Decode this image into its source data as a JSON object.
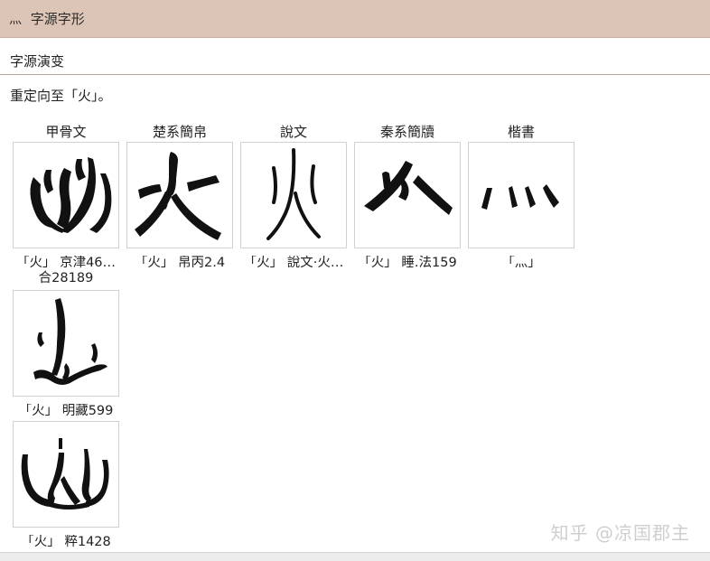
{
  "header": {
    "icon_text": "灬",
    "title": "字源字形"
  },
  "section_title": "字源演变",
  "description": "重定向至「火」。",
  "columns": [
    {
      "label": "甲骨文"
    },
    {
      "label": "楚系簡帛"
    },
    {
      "label": "說文"
    },
    {
      "label": "秦系簡牘"
    },
    {
      "label": "楷書"
    }
  ],
  "glyphs": [
    {
      "icon": "oracle-fire-glyph-1",
      "caption": "「火」 京津46…",
      "caption2": "合28189"
    },
    {
      "icon": "chu-fire-glyph",
      "caption": "「火」 帛丙2.4"
    },
    {
      "icon": "shuowen-fire-glyph",
      "caption": "「火」 說文·火…"
    },
    {
      "icon": "qin-fire-glyph",
      "caption": "「火」 睡.法159"
    },
    {
      "icon": "regular-script-huo-glyph",
      "caption": "「灬」"
    },
    {
      "icon": "oracle-fire-glyph-2",
      "caption": "「火」 明藏599"
    },
    {
      "icon": "oracle-fire-glyph-3",
      "caption": "「火」 粹1428"
    }
  ],
  "watermark": "知乎 @凉国郡主"
}
